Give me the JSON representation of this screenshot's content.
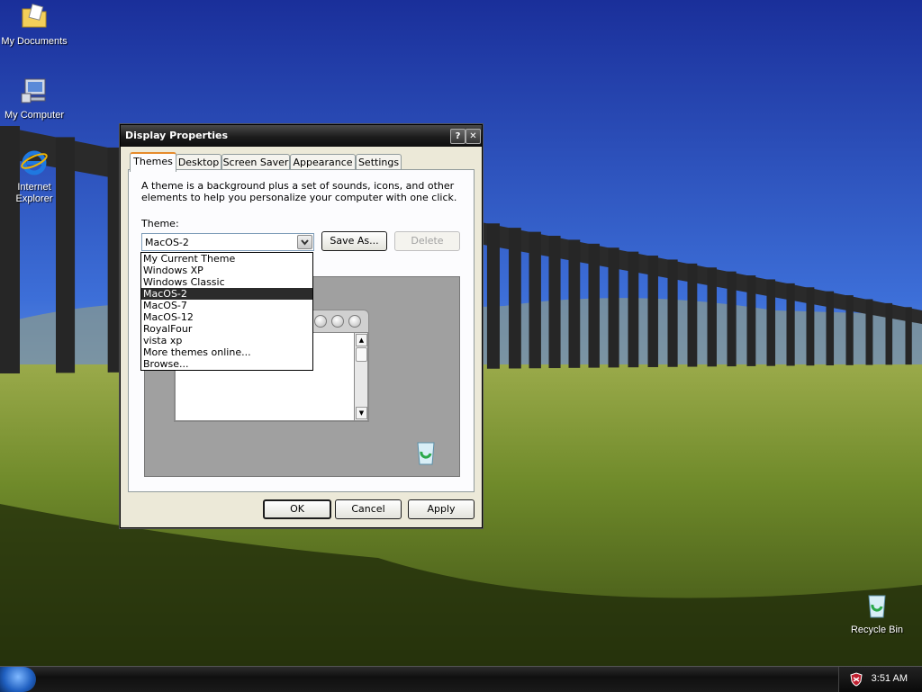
{
  "desktop": {
    "icons": [
      {
        "label": "My Documents",
        "icon": "folder-documents-icon"
      },
      {
        "label": "My Computer",
        "icon": "computer-icon"
      },
      {
        "label": "Internet Explorer",
        "icon": "internet-explorer-icon"
      },
      {
        "label": "Recycle Bin",
        "icon": "recycle-bin-icon"
      }
    ]
  },
  "taskbar": {
    "clock": "3:51 AM",
    "tray_icon": "security-shield-icon"
  },
  "dialog": {
    "title": "Display Properties",
    "help_label": "?",
    "close_label": "✕",
    "tabs": [
      {
        "label": "Themes",
        "active": true
      },
      {
        "label": "Desktop",
        "active": false
      },
      {
        "label": "Screen Saver",
        "active": false
      },
      {
        "label": "Appearance",
        "active": false
      },
      {
        "label": "Settings",
        "active": false
      }
    ],
    "description": "A theme is a background plus a set of sounds, icons, and other elements to help you personalize your computer with one click.",
    "theme_label": "Theme:",
    "theme_value": "MacOS-2",
    "save_as_label": "Save As...",
    "delete_label": "Delete",
    "theme_options": [
      "My Current Theme",
      "Windows XP",
      "Windows Classic",
      "MacOS-2",
      "MacOS-7",
      "MacOS-12",
      "RoyalFour",
      "vista xp",
      "More themes online...",
      "Browse..."
    ],
    "selected_option_index": 3,
    "ok_label": "OK",
    "cancel_label": "Cancel",
    "apply_label": "Apply"
  },
  "colors": {
    "sky_top": "#1f3ea8",
    "grass": "#6f8a2a",
    "selection": "#2b2b2b",
    "active_tab_accent": "#e68b2c"
  }
}
